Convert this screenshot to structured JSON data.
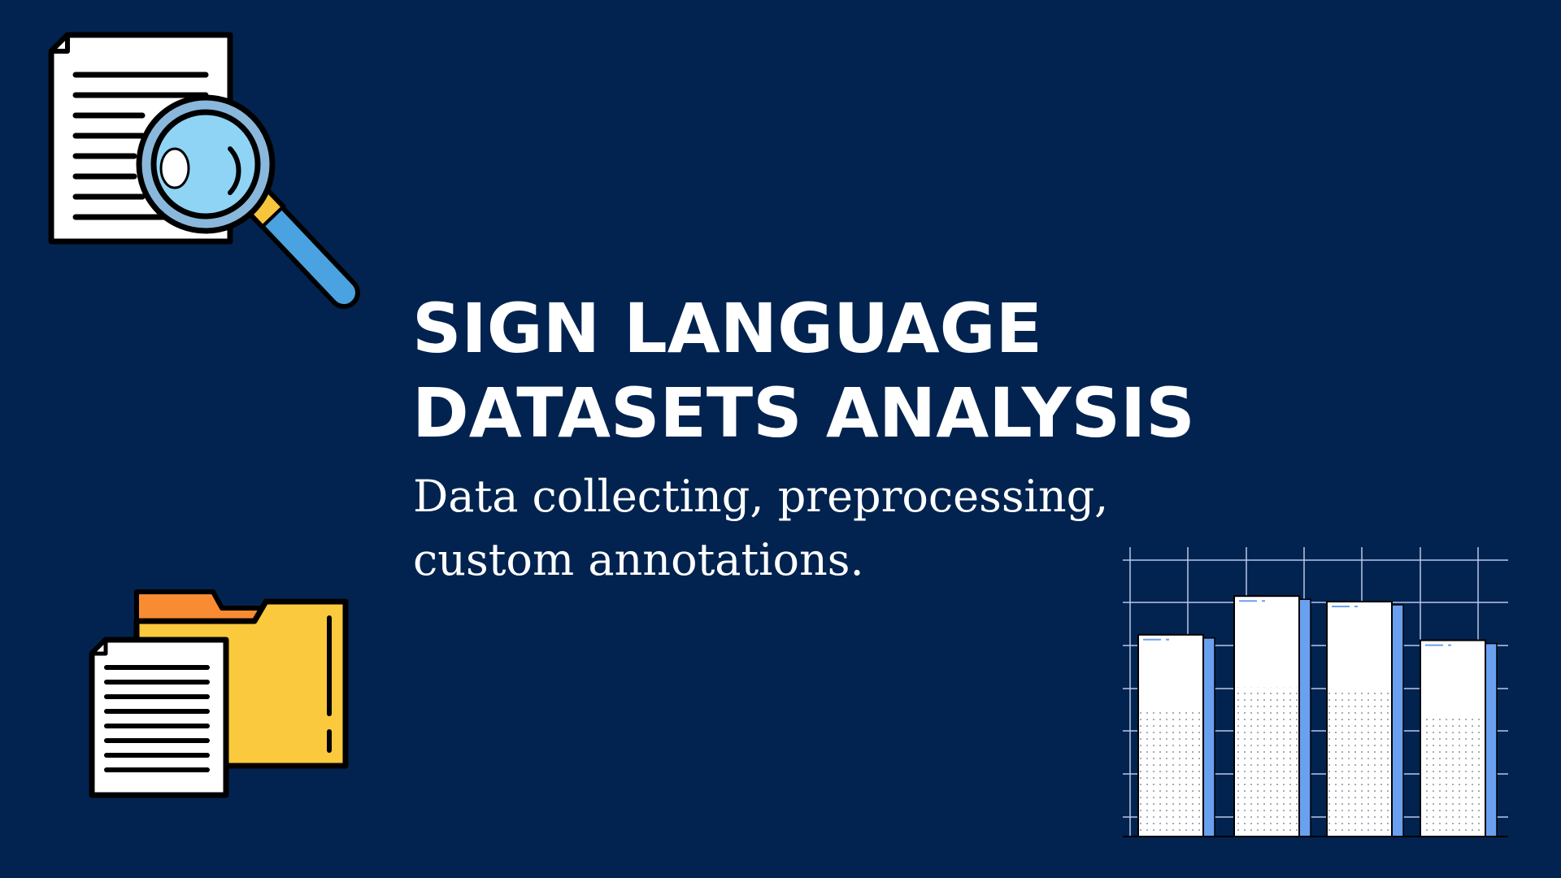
{
  "slide": {
    "title_lines": [
      "SIGN LANGUAGE",
      "DATASETS ANALYSIS"
    ],
    "subtitle_lines": [
      "Data collecting, preprocessing,",
      "custom annotations."
    ]
  },
  "colors": {
    "background": "#02234f",
    "text": "#ffffff",
    "paper": "#ffffff",
    "outline": "#000000",
    "lens": "#8fd4f5",
    "handle": "#4aa3e0",
    "handle_band": "#f7c53b",
    "folder_front": "#fbc93d",
    "folder_tab": "#f98b32",
    "bar_accent": "#6aa0f0",
    "grid": "#b8c8ea"
  },
  "icons": {
    "top_left": "document-magnifier-icon",
    "bottom_left": "folder-documents-icon",
    "bottom_right": "bar-graph-illustration"
  },
  "bar_graphic_levels": [
    0.73,
    0.87,
    0.85,
    0.71
  ]
}
